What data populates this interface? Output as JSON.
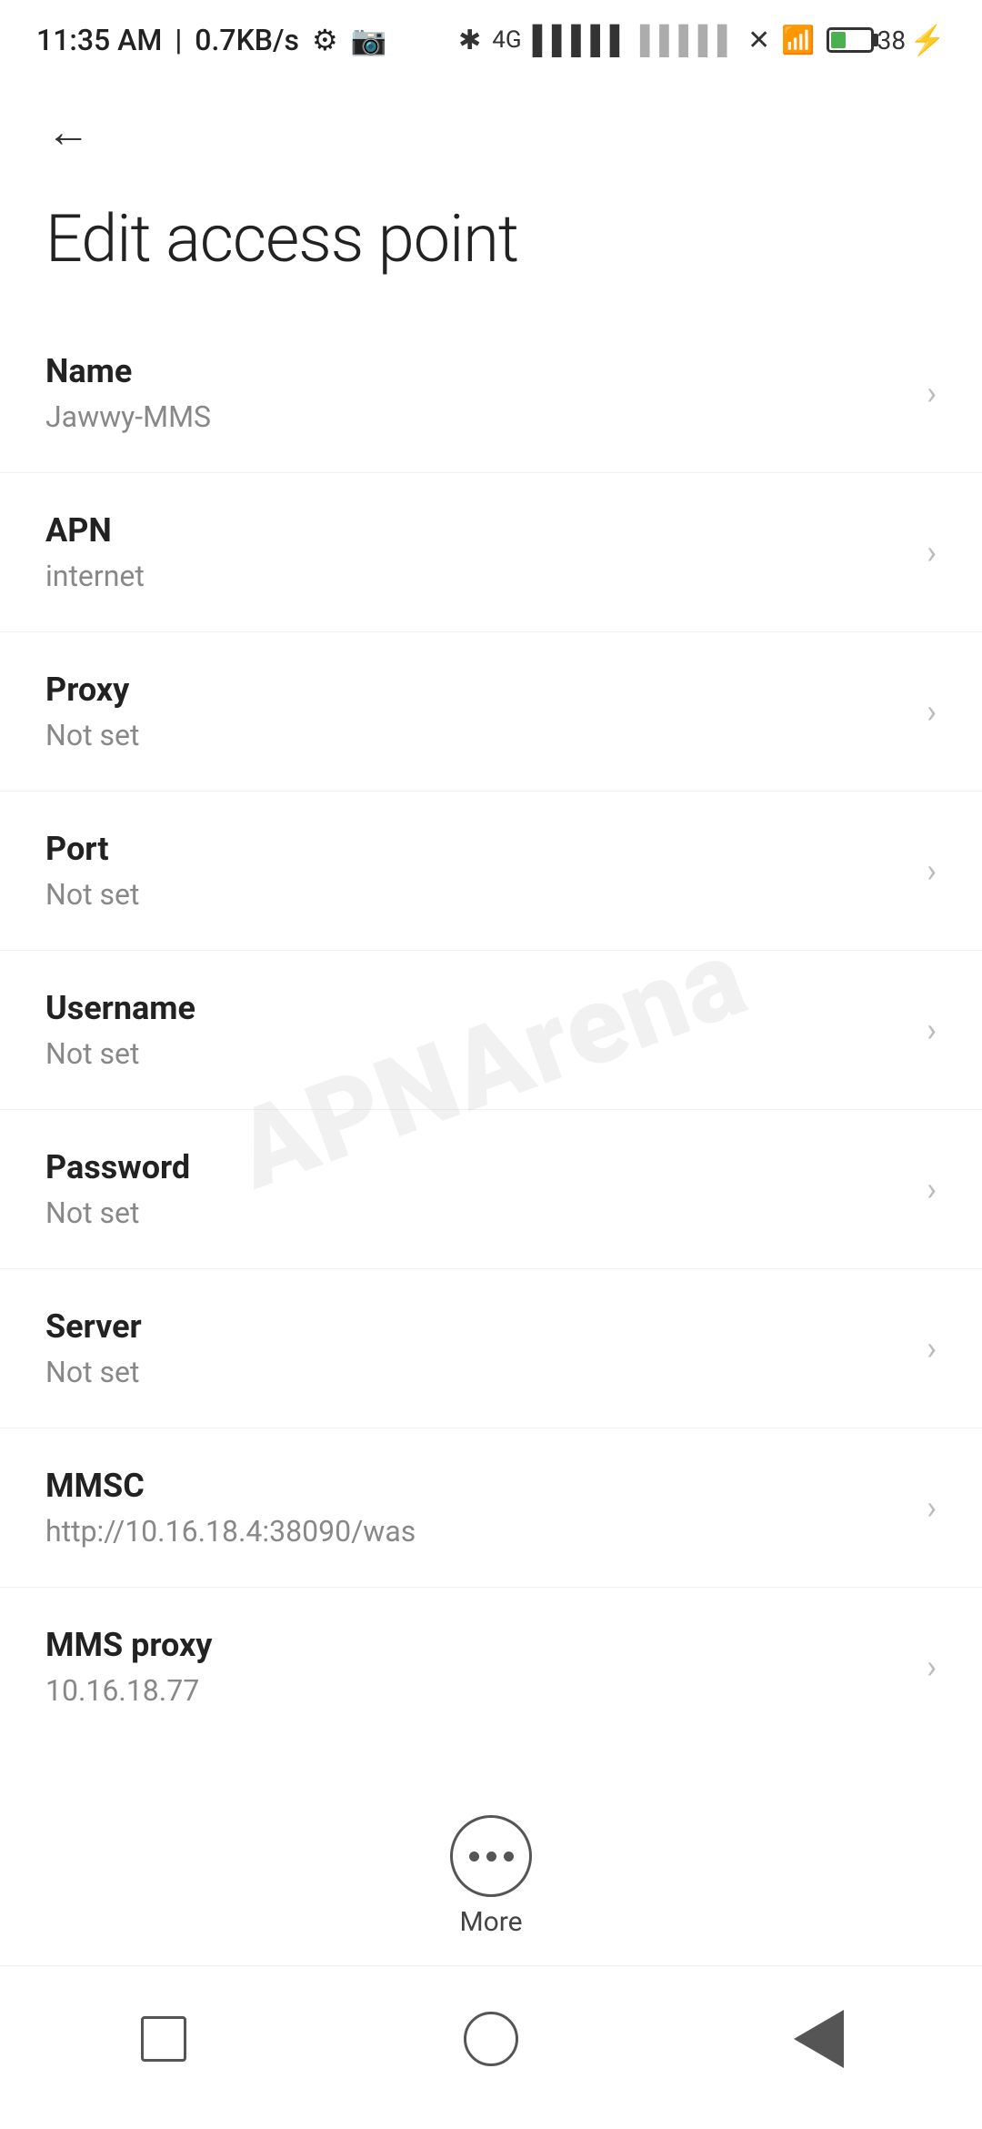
{
  "statusBar": {
    "time": "11:35 AM",
    "speed": "0.7KB/s"
  },
  "toolbar": {
    "backLabel": "←"
  },
  "page": {
    "title": "Edit access point"
  },
  "settings": [
    {
      "id": "name",
      "label": "Name",
      "value": "Jawwy-MMS"
    },
    {
      "id": "apn",
      "label": "APN",
      "value": "internet"
    },
    {
      "id": "proxy",
      "label": "Proxy",
      "value": "Not set"
    },
    {
      "id": "port",
      "label": "Port",
      "value": "Not set"
    },
    {
      "id": "username",
      "label": "Username",
      "value": "Not set"
    },
    {
      "id": "password",
      "label": "Password",
      "value": "Not set"
    },
    {
      "id": "server",
      "label": "Server",
      "value": "Not set"
    },
    {
      "id": "mmsc",
      "label": "MMSC",
      "value": "http://10.16.18.4:38090/was"
    },
    {
      "id": "mms-proxy",
      "label": "MMS proxy",
      "value": "10.16.18.77"
    }
  ],
  "more": {
    "label": "More"
  },
  "watermark": "APNArena"
}
